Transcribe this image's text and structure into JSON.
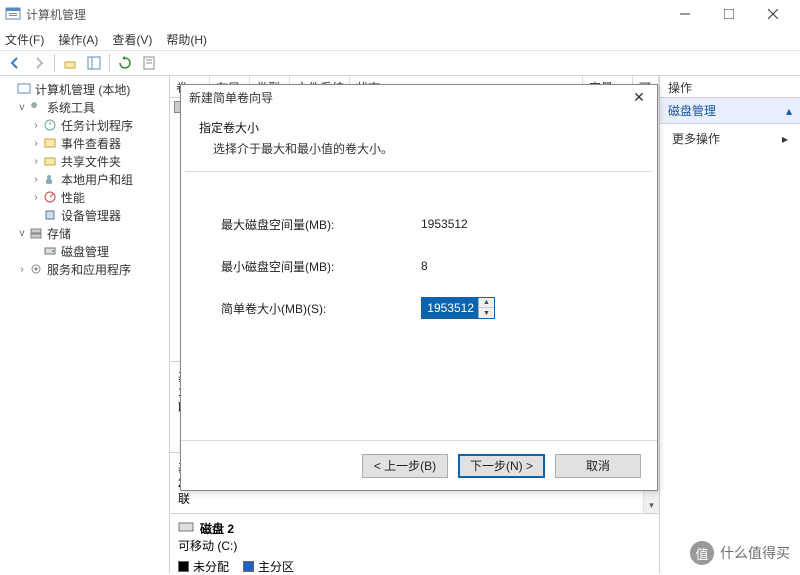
{
  "window": {
    "title": "计算机管理"
  },
  "menu": {
    "file": "文件(F)",
    "action": "操作(A)",
    "view": "查看(V)",
    "help": "帮助(H)"
  },
  "tree": {
    "root": "计算机管理 (本地)",
    "systools": "系统工具",
    "scheduler": "任务计划程序",
    "eventviewer": "事件查看器",
    "sharedfolders": "共享文件夹",
    "localusers": "本地用户和组",
    "performance": "性能",
    "devicemgr": "设备管理器",
    "storage": "存储",
    "diskmgmt": "磁盘管理",
    "services": "服务和应用程序"
  },
  "columns": {
    "volume": "卷",
    "layout": "布局",
    "type": "类型",
    "filesystem": "文件系统",
    "status": "状态",
    "capacity": "容量",
    "free": "可"
  },
  "actions": {
    "title": "操作",
    "header": "磁盘管理",
    "more": "更多操作"
  },
  "disk_stub": {
    "basic1_label": "基",
    "basic1_size": "19",
    "basic1_status": "联",
    "basic2_label": "基",
    "basic2_size": "23",
    "basic2_status": "联"
  },
  "disk_footer": {
    "name": "磁盘 2",
    "type": "可移动 (C:)",
    "legend_unalloc": "未分配",
    "legend_primary": "主分区"
  },
  "dialog": {
    "title": "新建简单卷向导",
    "heading": "指定卷大小",
    "subheading": "选择介于最大和最小值的卷大小。",
    "max_label": "最大磁盘空间量(MB):",
    "max_value": "1953512",
    "min_label": "最小磁盘空间量(MB):",
    "min_value": "8",
    "size_label": "简单卷大小(MB)(S):",
    "size_value": "1953512",
    "btn_back": "< 上一步(B)",
    "btn_next": "下一步(N) >",
    "btn_cancel": "取消"
  },
  "watermark": {
    "icon": "值",
    "text": "什么值得买"
  }
}
